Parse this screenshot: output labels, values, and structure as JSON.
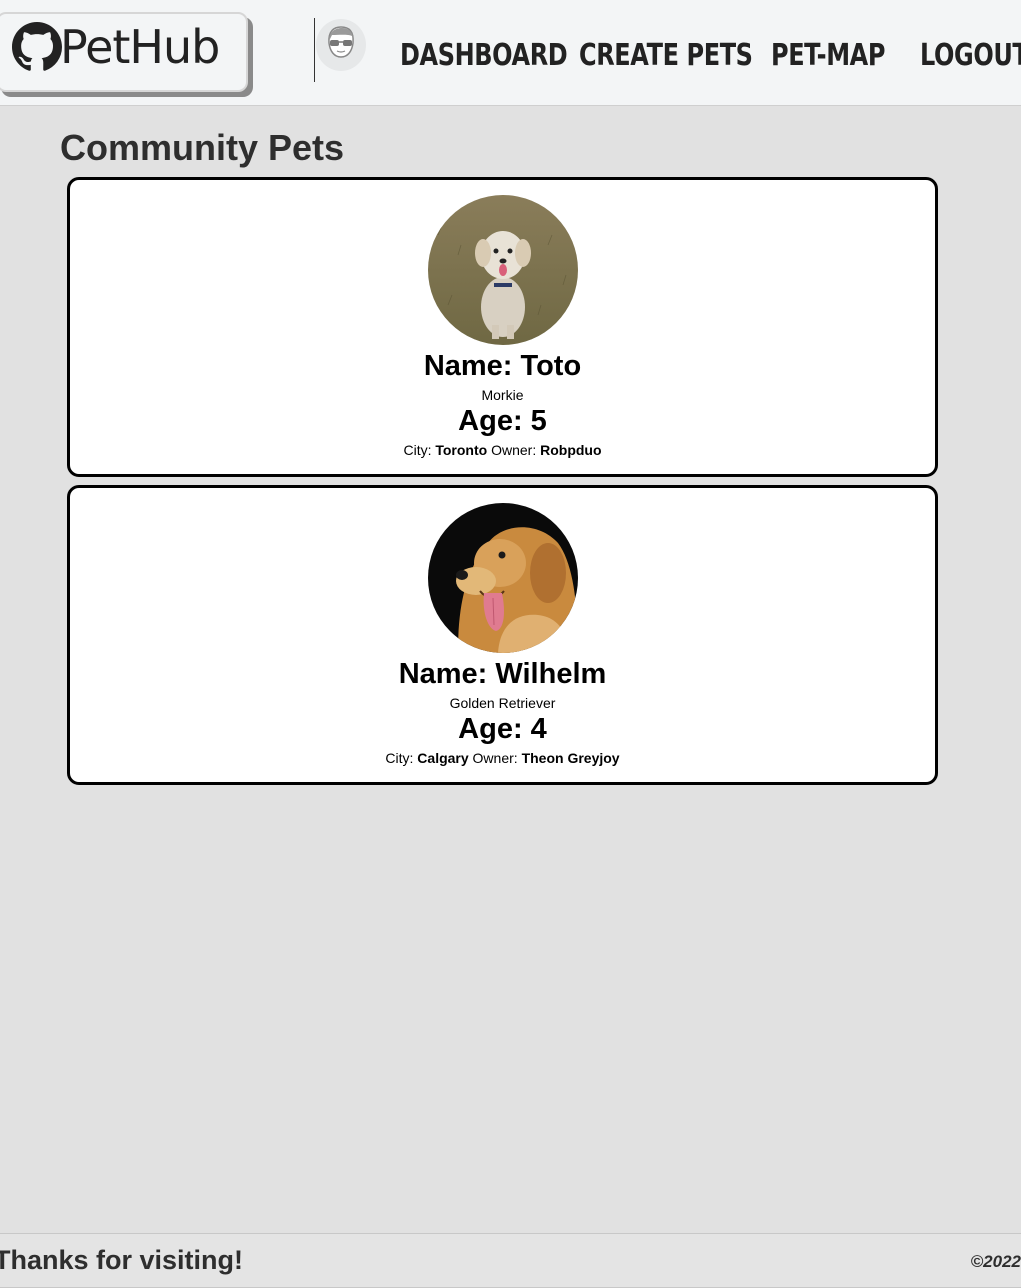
{
  "header": {
    "logo_text": "PetHub",
    "nav": [
      {
        "label": "DASHBOARD"
      },
      {
        "label": "CREATE PETS"
      },
      {
        "label": "PET-MAP"
      },
      {
        "label": "LOGOUT"
      }
    ]
  },
  "main": {
    "title": "Community Pets",
    "pets": [
      {
        "name_text": "Name: Toto",
        "breed": "Morkie",
        "age_text": "Age: 5",
        "city_label": "City:",
        "city": "Toronto",
        "owner_label": "Owner:",
        "owner": "Robpduo",
        "photo": "small-terrier-dog-photo"
      },
      {
        "name_text": "Name: Wilhelm",
        "breed": "Golden Retriever",
        "age_text": "Age: 4",
        "city_label": "City:",
        "city": "Calgary",
        "owner_label": "Owner:",
        "owner": "Theon Greyjoy",
        "photo": "golden-retriever-photo"
      }
    ]
  },
  "footer": {
    "message": "Thanks for visiting!",
    "copyright": "©2022"
  },
  "colors": {
    "page_bg": "#e1e1e1",
    "header_bg": "#f3f5f6",
    "card_bg": "#ffffff",
    "card_border": "#000000"
  }
}
